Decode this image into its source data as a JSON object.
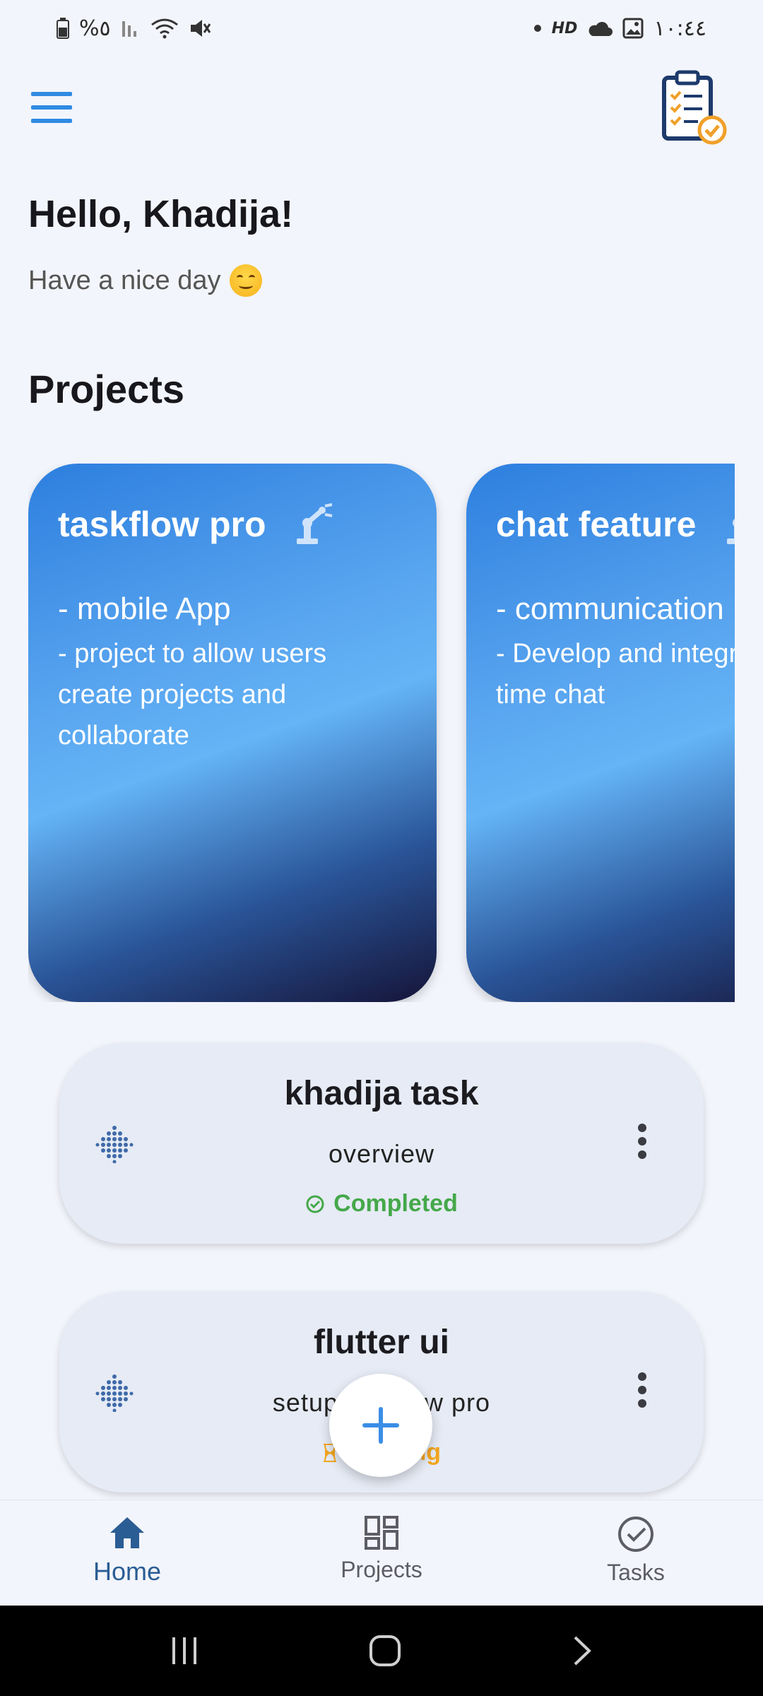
{
  "status_bar": {
    "battery": "%٥",
    "time": "١٠:٤٤",
    "hd_badge": "HD"
  },
  "header": {
    "menu_icon": "hamburger-menu-icon",
    "logo_icon": "clipboard-checklist-icon"
  },
  "greeting": {
    "title": "Hello, Khadija!",
    "subtitle": "Have a nice day"
  },
  "projects_section": {
    "title": "Projects",
    "cards": [
      {
        "title": "taskflow pro",
        "line1": "- mobile App",
        "line2": "- project to allow users create projects and collaborate",
        "icon": "robot-arm-icon"
      },
      {
        "title": "chat feature",
        "line1": "- communication module",
        "line2": "- Develop and integrate real time chat",
        "icon": "robot-arm-icon"
      }
    ]
  },
  "tasks": [
    {
      "title": "khadija task",
      "subtitle": "overview",
      "status": "Completed",
      "status_color": "#45a84a"
    },
    {
      "title": "flutter ui",
      "subtitle": "setup taskflow pro",
      "status": "Pending",
      "status_color": "#f2a61f"
    }
  ],
  "fab": {
    "icon": "plus-icon"
  },
  "bottom_nav": {
    "items": [
      {
        "label": "Home",
        "icon": "home-icon",
        "active": true
      },
      {
        "label": "Projects",
        "icon": "dashboard-grid-icon",
        "active": false
      },
      {
        "label": "Tasks",
        "icon": "check-circle-icon",
        "active": false
      }
    ]
  },
  "colors": {
    "accent": "#2f8be3",
    "active_nav": "#2a5d94",
    "background": "#f3f5fc"
  }
}
